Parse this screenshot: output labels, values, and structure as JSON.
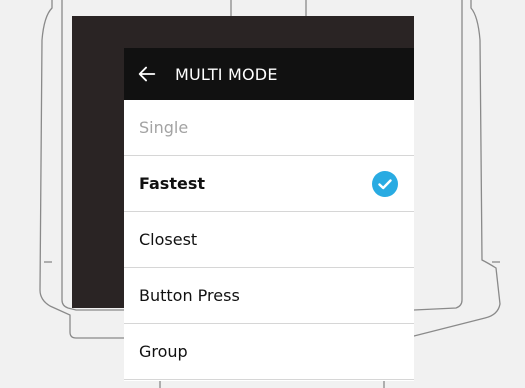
{
  "header": {
    "back_icon": "arrow-left-icon",
    "title": "MULTI MODE"
  },
  "options": [
    {
      "label": "Single",
      "state": "disabled"
    },
    {
      "label": "Fastest",
      "state": "selected"
    },
    {
      "label": "Closest",
      "state": "normal"
    },
    {
      "label": "Button Press",
      "state": "normal"
    },
    {
      "label": "Group",
      "state": "normal"
    }
  ],
  "selected_icon": "check-circle-icon",
  "colors": {
    "page_background": "#f1f1f1",
    "device_outline": "#8a8a8a",
    "screen_background": "#2a2424",
    "header_background": "#111111",
    "panel_background": "#ffffff",
    "text_primary": "#111111",
    "text_disabled": "#a3a3a3",
    "divider": "#d6d6d6",
    "accent": "#29abe2"
  }
}
